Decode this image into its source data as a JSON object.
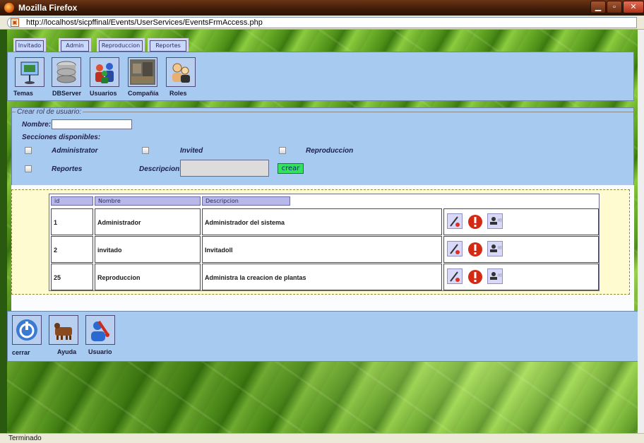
{
  "window": {
    "title": "Mozilla Firefox"
  },
  "browser": {
    "url": "http://localhost/sicpffinal/Events/UserServices/EventsFrmAccess.php",
    "status": "Terminado"
  },
  "tabs": [
    "Invitado",
    "Admin",
    "Reproduccion",
    "Reportes"
  ],
  "toolbar": [
    "Temas",
    "DBServer",
    "Usuarios",
    "Compañía",
    "Roles"
  ],
  "form": {
    "legend": "Crear rol de usuario:",
    "nombre_label": "Nombre:",
    "nombre_value": "",
    "sections_label": "Secciones disponibles:",
    "sections": [
      "Administrator",
      "Invited",
      "Reproduccion",
      "Reportes"
    ],
    "descripcion_label": "Descripcion:",
    "descripcion_value": "",
    "crear": "crear"
  },
  "table": {
    "headers": [
      "id",
      "Nombre",
      "Descripcion"
    ],
    "rows": [
      {
        "id": "1",
        "nombre": "Administrador",
        "descripcion": "Administrador del sistema"
      },
      {
        "id": "2",
        "nombre": "invitado",
        "descripcion": "Invitadoll"
      },
      {
        "id": "25",
        "nombre": "Reproduccion",
        "descripcion": "Administra la creacion de plantas"
      }
    ],
    "action_icons": [
      "edit-icon",
      "delete-icon",
      "user-access-icon"
    ]
  },
  "bottom": [
    "cerrar",
    "Ayuda",
    "Usuario"
  ],
  "colors": {
    "panel": "#a6caf0",
    "crear": "#38e060",
    "table_area": "#fffbd0",
    "titlebar": "#4a220c"
  }
}
